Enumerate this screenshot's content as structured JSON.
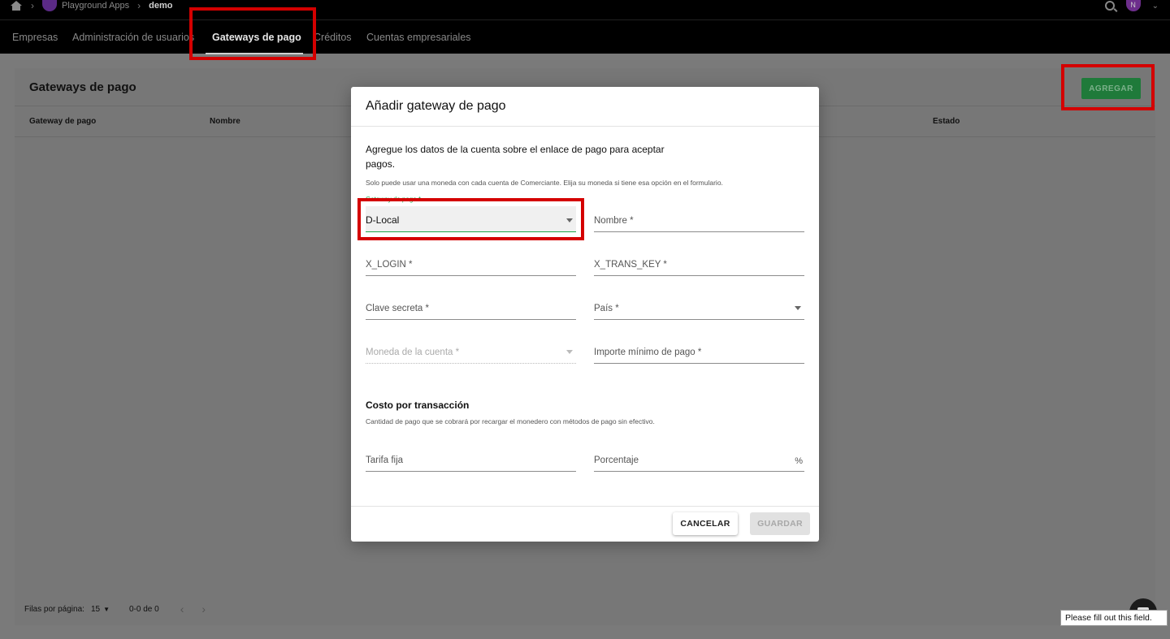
{
  "breadcrumb": {
    "home_icon": "home-icon",
    "app": "Playground Apps",
    "page": "demo"
  },
  "header": {
    "avatar_initial": "N",
    "search_icon": "search-icon"
  },
  "nav": {
    "tabs": [
      {
        "label": "Empresas"
      },
      {
        "label": "Administración de usuarios"
      },
      {
        "label": "Gateways de pago",
        "active": true
      },
      {
        "label": "Créditos"
      },
      {
        "label": "Cuentas empresariales"
      }
    ]
  },
  "panel": {
    "title": "Gateways de pago",
    "add_label": "AGREGAR",
    "columns": [
      "Gateway de pago",
      "Nombre",
      "Estado"
    ],
    "pagination": {
      "rows_label": "Filas por página:",
      "rows_value": "15",
      "range": "0-0 de 0"
    }
  },
  "modal": {
    "title": "Añadir gateway de pago",
    "intro": "Agregue los datos de la cuenta sobre el enlace de pago para aceptar pagos.",
    "currency_hint": "Solo puede usar una moneda con cada cuenta de Comerciante. Elija su moneda si tiene esa opción en el formulario.",
    "fields": {
      "gateway_label": "Gateway de pago *",
      "gateway_value": "D-Local",
      "nombre": "Nombre *",
      "x_login": "X_LOGIN *",
      "x_trans_key": "X_TRANS_KEY *",
      "clave_secreta": "Clave secreta *",
      "pais": "País *",
      "moneda": "Moneda de la cuenta *",
      "importe_minimo": "Importe mínimo de pago *",
      "tarifa_fija": "Tarifa fija",
      "porcentaje": "Porcentaje",
      "porcentaje_suffix": "%"
    },
    "cost_section_title": "Costo por transacción",
    "cost_hint": "Cantidad de pago que se cobrará por recargar el monedero con métodos de pago sin efectivo.",
    "cancel_label": "CANCELAR",
    "save_label": "GUARDAR"
  },
  "validation_tooltip": "Please fill out this field.",
  "colors": {
    "accent_green": "#1fa64a",
    "highlight_red": "#d40000"
  }
}
